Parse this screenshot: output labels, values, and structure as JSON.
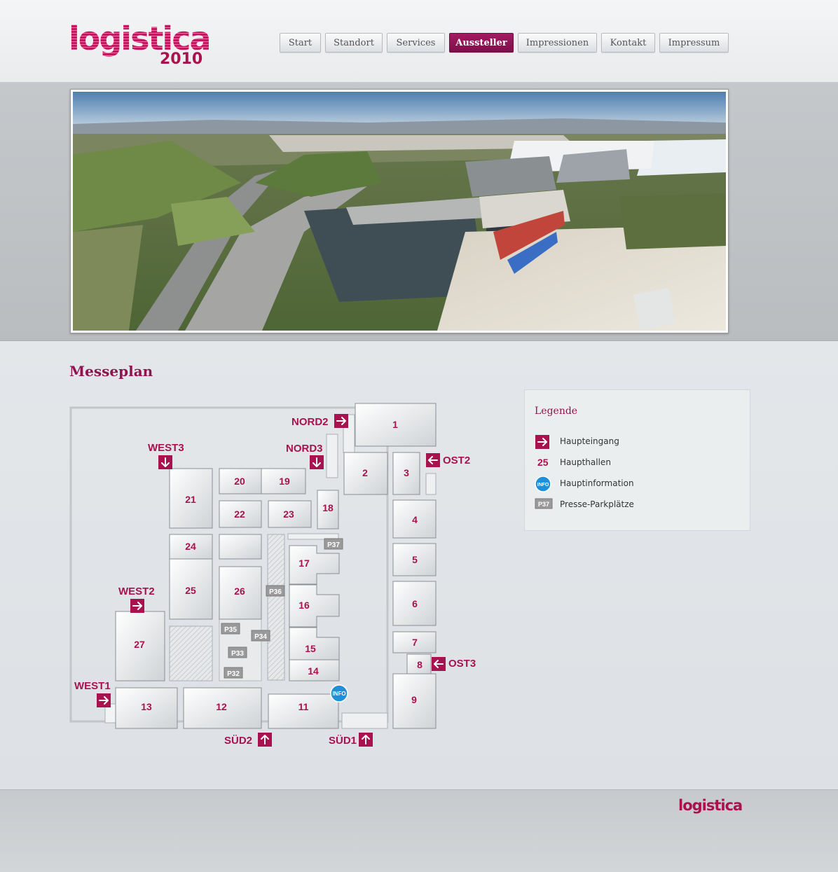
{
  "header": {
    "logo_text": "logistica",
    "logo_year": "2010",
    "nav": [
      "Start",
      "Standort",
      "Services",
      "Aussteller",
      "Impressionen",
      "Kontakt",
      "Impressum"
    ],
    "active_nav": "Aussteller"
  },
  "page": {
    "title": "Messeplan"
  },
  "map": {
    "halls": [
      "1",
      "2",
      "3",
      "4",
      "5",
      "6",
      "7",
      "8",
      "9",
      "11",
      "12",
      "13",
      "14",
      "15",
      "16",
      "17",
      "18",
      "19",
      "20",
      "21",
      "22",
      "23",
      "24",
      "25",
      "26",
      "27"
    ],
    "entrances": [
      "NORD2",
      "NORD3",
      "WEST3",
      "WEST2",
      "WEST1",
      "OST2",
      "OST3",
      "SÜD2",
      "SÜD1"
    ],
    "parking": [
      "P32",
      "P33",
      "P34",
      "P35",
      "P36",
      "P37"
    ],
    "info_label": "INFO"
  },
  "legend": {
    "title": "Legende",
    "items": [
      {
        "label": "Haupteingang"
      },
      {
        "label": "Haupthallen",
        "symbol": "25"
      },
      {
        "label": "Hauptinformation",
        "symbol": "INFO"
      },
      {
        "label": "Presse-Parkplätze",
        "symbol": "P37"
      }
    ]
  },
  "footer": {
    "logo_text": "logistica"
  },
  "colors": {
    "brand": "#a8124f",
    "active_nav": "#8e1550",
    "info_blue": "#1e8fd8",
    "parking_gray": "#9a9a9a"
  }
}
